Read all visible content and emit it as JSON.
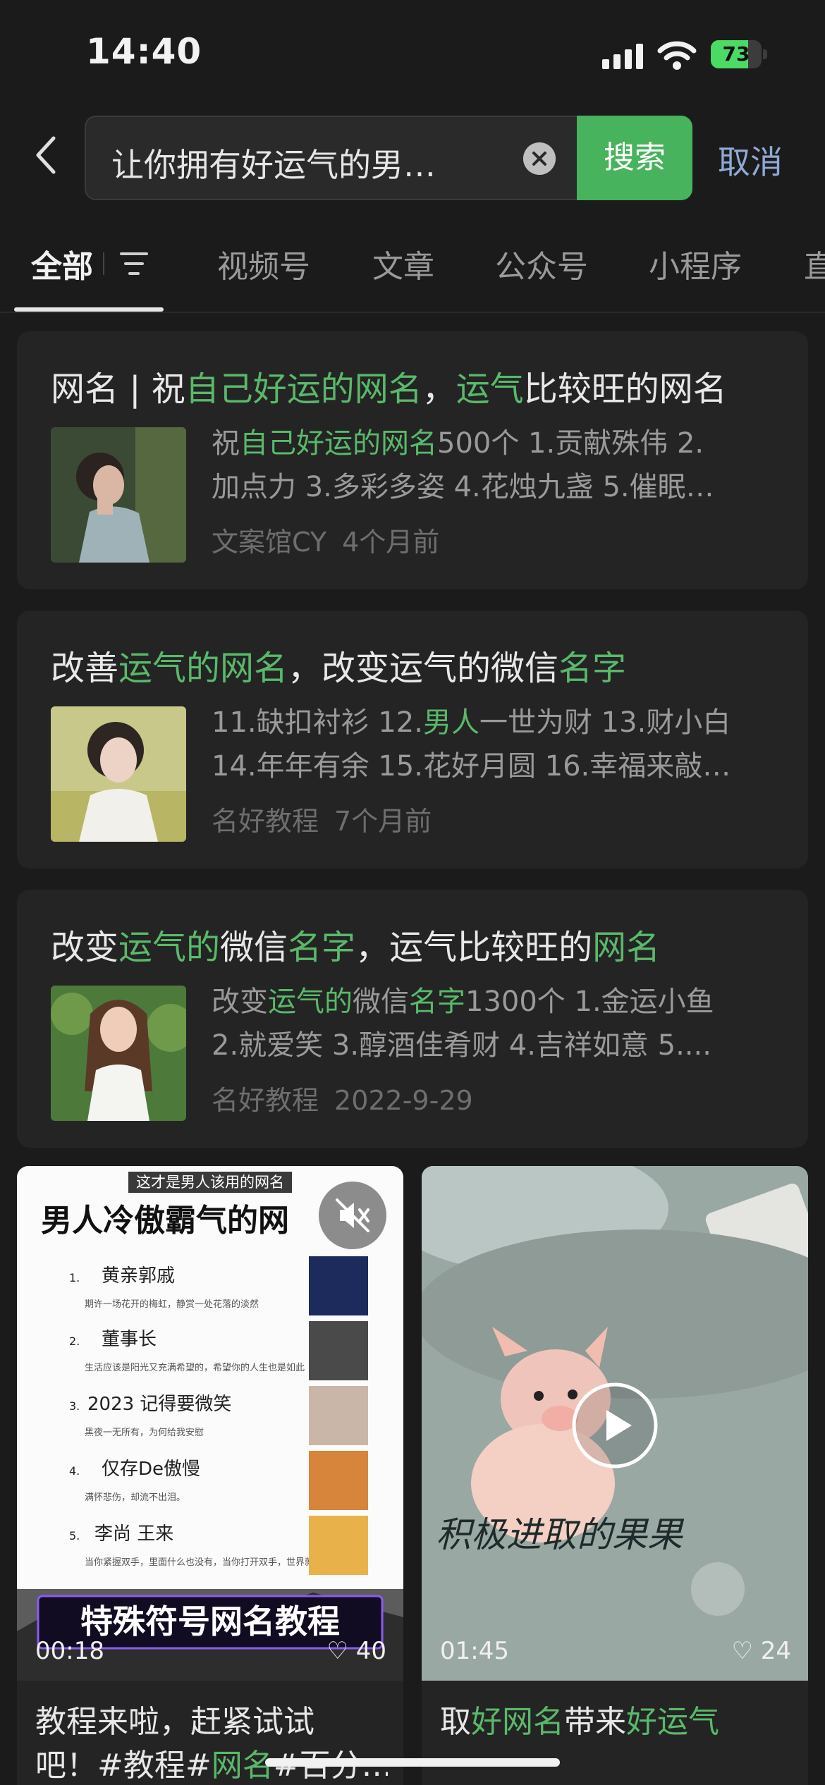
{
  "status": {
    "time": "14:40",
    "battery_level": "73",
    "battery_fraction": 0.73,
    "battery_color": "#4cd964",
    "icons": [
      "signal-icon",
      "wifi-icon",
      "battery-charging-icon"
    ]
  },
  "search": {
    "query": "让你拥有好运气的男…",
    "search_label": "搜索",
    "cancel_label": "取消",
    "accent_color": "#47b35c"
  },
  "tabs": [
    {
      "label": "全部",
      "active": true
    },
    {
      "label": "视频号"
    },
    {
      "label": "文章"
    },
    {
      "label": "公众号"
    },
    {
      "label": "小程序"
    },
    {
      "label": "直"
    }
  ],
  "results": [
    {
      "title_parts": [
        "网名 | 祝",
        "自己好运的网名",
        "，",
        "运气",
        "比较旺的网名"
      ],
      "desc_line1_parts": [
        "祝",
        "自己好运的网名",
        "500个 1.贡献殊伟 2."
      ],
      "desc_line2": "加点力 3.多彩多姿 4.花烛九盏 5.催眠…",
      "source": "文案馆CY",
      "time": "4个月前"
    },
    {
      "title_parts": [
        "改善",
        "运气的网名",
        "，改变运气的微信",
        "名字"
      ],
      "desc_line1_parts": [
        "11.缺扣衬衫 12.",
        "男人",
        "一世为财 13.财小白"
      ],
      "desc_line2": "14.年年有余 15.花好月圆 16.幸福来敲…",
      "source": "名好教程",
      "time": "7个月前"
    },
    {
      "title_parts": [
        "改变",
        "运气的",
        "微信",
        "名字",
        "，运气比较旺的",
        "网名"
      ],
      "desc_line1_parts": [
        "改变",
        "运气的",
        "微信",
        "名字",
        "1300个 1.金运小鱼"
      ],
      "desc_line2": "2.就爱笑 3.醇酒佳肴财 4.吉祥如意 5....",
      "source": "名好教程",
      "time": "2022-9-29"
    }
  ],
  "videos": [
    {
      "tag": "这才是男人该用的网名",
      "headline": "男人冷傲霸气的网",
      "list": [
        {
          "num": "1.",
          "name": "黄亲郭戚",
          "sub": "期许一场花开的梅虹，静赏一处花落的淡然"
        },
        {
          "num": "2.",
          "name": "董事长",
          "sub": "生活应该是阳光又充满希望的，希望你的人生也是如此"
        },
        {
          "num": "3.",
          "name": "2023 记得要微笑",
          "sub": "黑夜一无所有，为何给我安慰"
        },
        {
          "num": "4.",
          "name": "仅存De傲慢",
          "sub": "满怀悲伤，却流不出泪。"
        },
        {
          "num": "5.",
          "name": "李尚 王来",
          "sub": "当你紧握双手，里面什么也没有，当你打开双手，世界就在你手中"
        }
      ],
      "banner": "特殊符号网名教程",
      "duration": "00:18",
      "likes": "40",
      "title_line1_parts": [
        "教程来啦，赶紧试试"
      ],
      "title_line2_parts": [
        "吧！#教程#",
        "网名",
        "#百分…"
      ]
    },
    {
      "handwriting": "积极进取的果果",
      "duration": "01:45",
      "likes": "24",
      "title_line1_parts": [
        "取",
        "好网名",
        "带来",
        "好运气"
      ]
    }
  ]
}
